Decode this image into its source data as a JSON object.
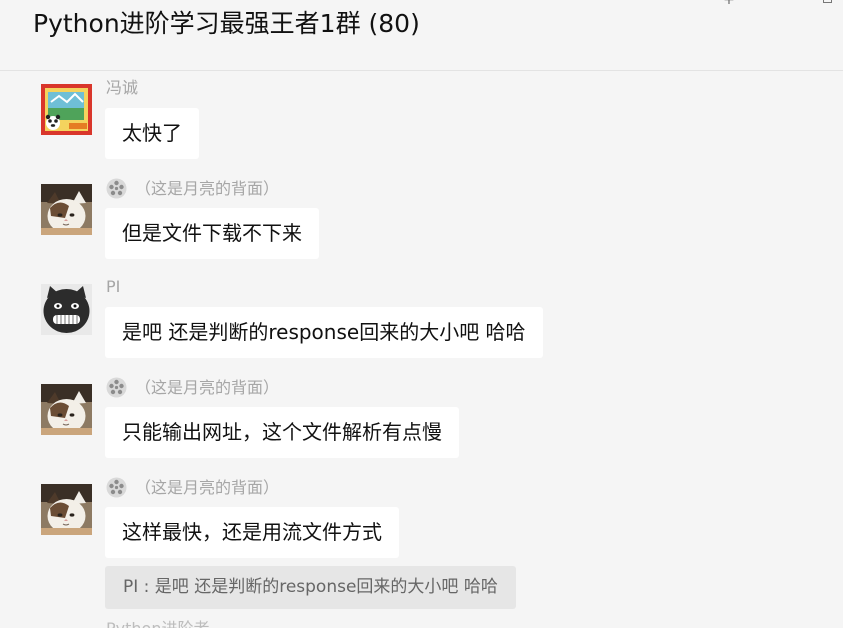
{
  "chat": {
    "title": "Python进阶学习最强王者1群 (80)"
  },
  "window_controls": {
    "plus_icon": "plus-icon",
    "maximize_icon": "maximize-icon"
  },
  "messages": [
    {
      "sender": "冯诚",
      "text": "太快了",
      "avatar": "red-panda-avatar"
    },
    {
      "sender": "（这是月亮的背面）",
      "text": "但是文件下载不下来",
      "avatar": "cat-avatar",
      "sender_icon": "emoji-icon"
    },
    {
      "sender": "PI",
      "text": "是吧 还是判断的response回来的大小吧 哈哈",
      "avatar": "black-cat-avatar"
    },
    {
      "sender": "（这是月亮的背面）",
      "text": "只能输出网址，这个文件解析有点慢",
      "avatar": "cat-avatar",
      "sender_icon": "emoji-icon"
    },
    {
      "sender": "（这是月亮的背面）",
      "text": "这样最快，还是用流文件方式",
      "avatar": "cat-avatar",
      "sender_icon": "emoji-icon"
    }
  ],
  "quote": {
    "text": "PI : 是吧 还是判断的response回来的大小吧 哈哈"
  },
  "next_sender": {
    "name": "Python进阶者"
  }
}
